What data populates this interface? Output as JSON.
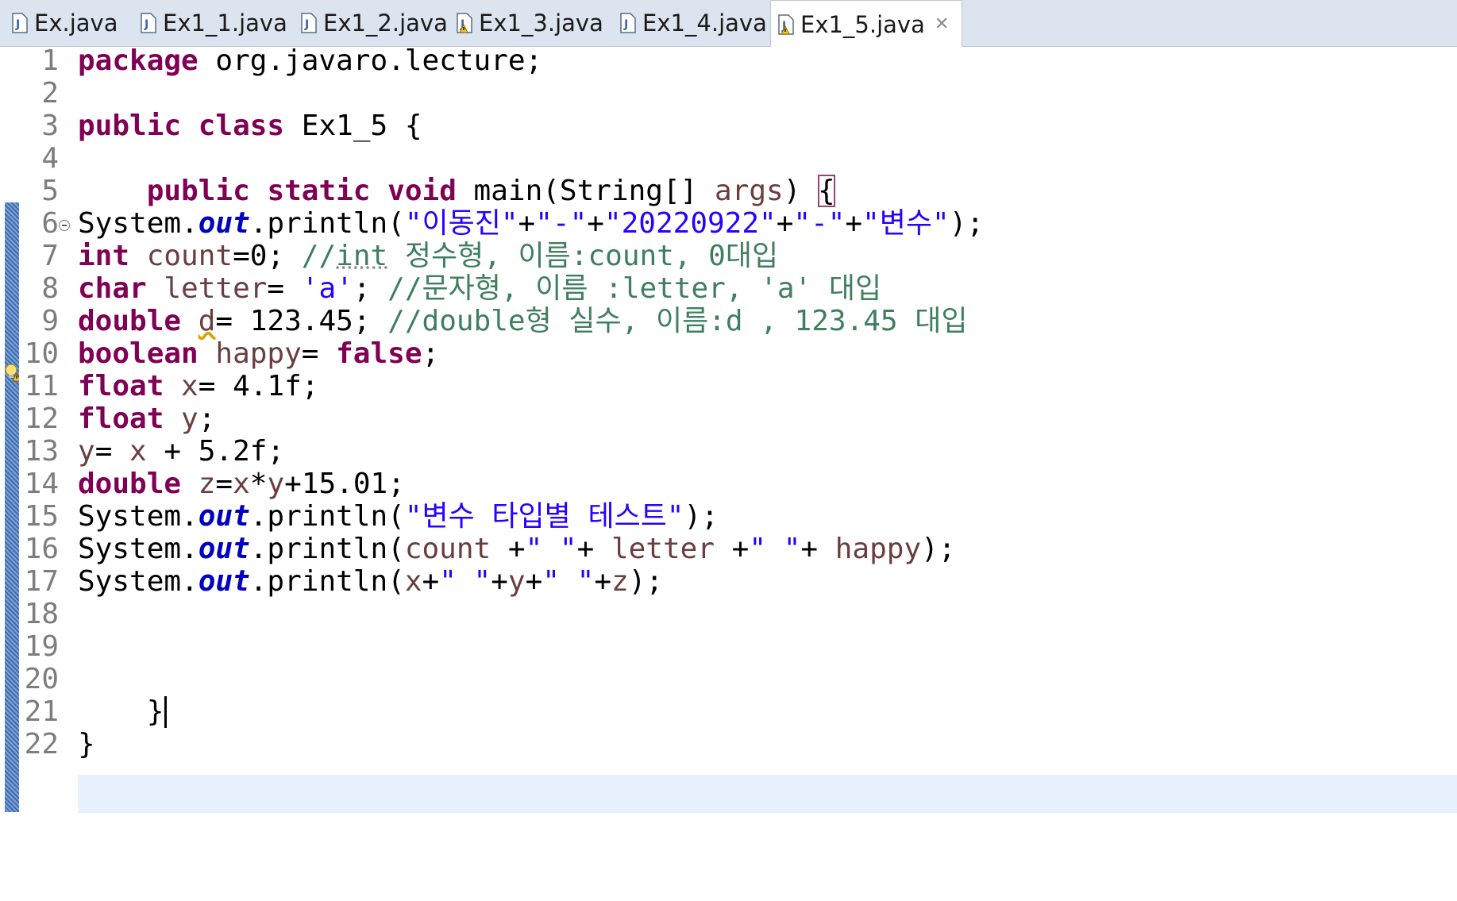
{
  "tabs": [
    {
      "label": "Ex.java",
      "warning": false,
      "active": false
    },
    {
      "label": "Ex1_1.java",
      "warning": false,
      "active": false
    },
    {
      "label": "Ex1_2.java",
      "warning": false,
      "active": false
    },
    {
      "label": "Ex1_3.java",
      "warning": true,
      "active": false
    },
    {
      "label": "Ex1_4.java",
      "warning": false,
      "active": false
    },
    {
      "label": "Ex1_5.java",
      "warning": true,
      "active": true
    }
  ],
  "tab_close_glyph": "✕",
  "line_numbers": [
    "1",
    "2",
    "3",
    "4",
    "5",
    "6",
    "7",
    "8",
    "9",
    "10",
    "11",
    "12",
    "13",
    "14",
    "15",
    "16",
    "17",
    "18",
    "19",
    "20",
    "21",
    "22"
  ],
  "code": {
    "l1": {
      "kw": "package",
      "rest": " org.javaro.lecture;"
    },
    "l3": {
      "kw1": "public",
      "kw2": "class",
      "rest": " Ex1_5 {"
    },
    "l5": {
      "indent": "    ",
      "kw1": "public",
      "kw2": "static",
      "kw3": "void",
      "name": " main(String[] ",
      "arg": "args",
      "close": ") ",
      "brace": "{"
    },
    "l6": {
      "obj": "System.",
      "fld": "out",
      "call": ".println(",
      "s1": "\"이동진\"",
      "p1": "+",
      "s2": "\"-\"",
      "p2": "+",
      "s3": "\"20220922\"",
      "p3": "+",
      "s4": "\"-\"",
      "p4": "+",
      "s5": "\"변수\"",
      "end": ");"
    },
    "l7": {
      "kw": "int",
      "var": " count",
      "rest": "=0; ",
      "cm": "//",
      "cm_int": "int",
      "cm_rest": " 정수형, 이름:count, 0대입"
    },
    "l8": {
      "kw": "char",
      "var": " letter",
      "rest": "= ",
      "str": "'a'",
      "rest2": "; ",
      "cm": "//문자형, 이름 :letter, 'a' 대입"
    },
    "l9": {
      "kw": "double",
      "sp": " ",
      "var": "d",
      "rest": "= 123.45; ",
      "cm": "//double형 실수, 이름:d , 123.45 대입"
    },
    "l10": {
      "kw": "boolean",
      "var": " happy",
      "rest": "= ",
      "kw2": "false",
      "end": ";"
    },
    "l11": {
      "kw": "float",
      "var": " x",
      "rest": "= 4.1f;"
    },
    "l12": {
      "kw": "float",
      "var": " y",
      "rest": ";"
    },
    "l13": {
      "var1": "y",
      "rest1": "= ",
      "var2": "x",
      "rest2": " + 5.2f;"
    },
    "l14": {
      "kw": "double",
      "var": " z",
      "rest1": "=",
      "v1": "x",
      "op": "*",
      "v2": "y",
      "rest2": "+15.01;"
    },
    "l15": {
      "obj": "System.",
      "fld": "out",
      "call": ".println(",
      "s1": "\"변수 타입별 테스트\"",
      "end": ");"
    },
    "l16": {
      "obj": "System.",
      "fld": "out",
      "call": ".println(",
      "v1": "count",
      "p1": " +",
      "s1": "\" \"",
      "p2": "+ ",
      "v2": "letter",
      "p3": " +",
      "s2": "\" \"",
      "p4": "+ ",
      "v3": "happy",
      "end": ");"
    },
    "l17": {
      "obj": "System.",
      "fld": "out",
      "call": ".println(",
      "v1": "x",
      "p1": "+",
      "s1": "\" \"",
      "p2": "+",
      "v2": "y",
      "p3": "+",
      "s2": "\" \"",
      "p4": "+",
      "v3": "z",
      "end": ");"
    },
    "l20": {
      "indent": "    ",
      "brace": "}"
    },
    "l21": {
      "brace": "}"
    }
  },
  "colors": {
    "keyword": "#7f0055",
    "string": "#2a00ff",
    "comment": "#3f7f5f",
    "static_field": "#0000c0",
    "local_variable": "#6a3e3e",
    "current_line": "#e8f2fe"
  },
  "icons": {
    "java_file": "java-file-icon",
    "java_file_warning": "java-file-warning-icon",
    "warning_marker": "warning-lightbulb-icon",
    "fold": "fold-collapse-icon"
  }
}
